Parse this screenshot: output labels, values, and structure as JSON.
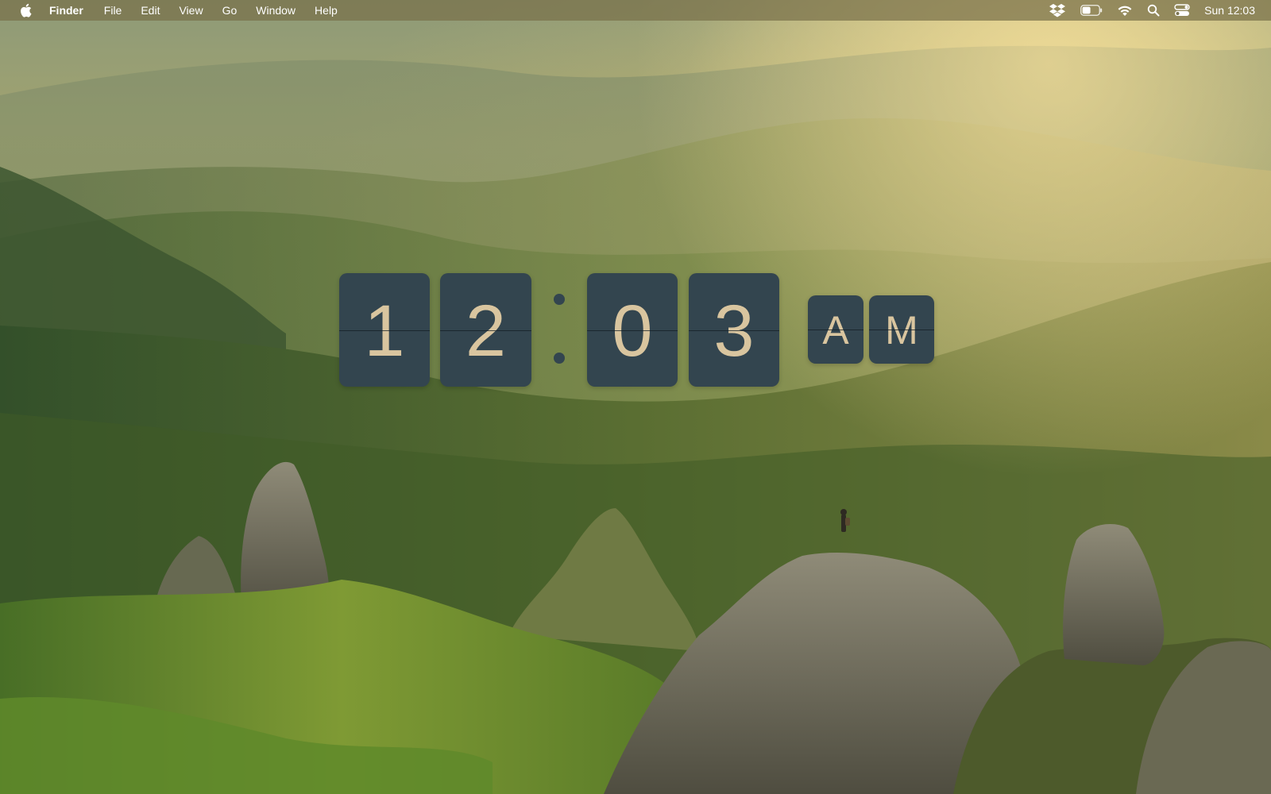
{
  "menubar": {
    "apple_icon": "apple-logo-icon",
    "app_name": "Finder",
    "items": [
      "File",
      "Edit",
      "View",
      "Go",
      "Window",
      "Help"
    ],
    "status_icons": [
      "dropbox-icon",
      "battery-icon",
      "wifi-icon",
      "search-icon",
      "control-center-icon"
    ],
    "clock": "Sun 12:03"
  },
  "flip_clock": {
    "hour_tens": "1",
    "hour_ones": "2",
    "minute_tens": "0",
    "minute_ones": "3",
    "period_first": "A",
    "period_second": "M",
    "card_color": "#33454f",
    "digit_color": "#d9c59f"
  },
  "wallpaper": {
    "description_icon": "landscape-wallpaper"
  }
}
